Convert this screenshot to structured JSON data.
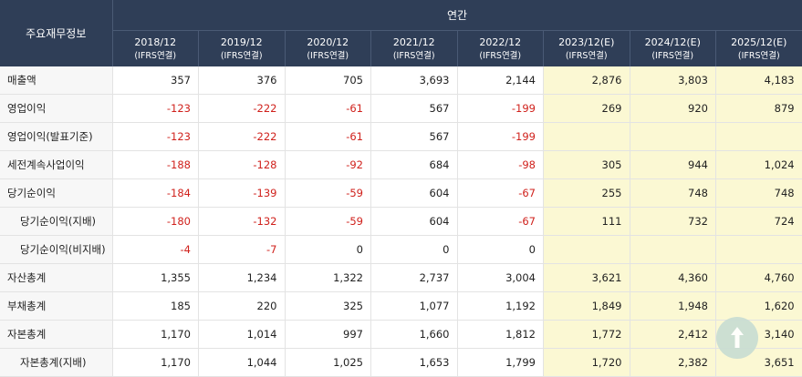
{
  "header": {
    "label": "주요재무정보",
    "span": "연간",
    "years": [
      {
        "year": "2018/12",
        "sub": "(IFRS연결)"
      },
      {
        "year": "2019/12",
        "sub": "(IFRS연결)"
      },
      {
        "year": "2020/12",
        "sub": "(IFRS연결)"
      },
      {
        "year": "2021/12",
        "sub": "(IFRS연결)"
      },
      {
        "year": "2022/12",
        "sub": "(IFRS연결)"
      },
      {
        "year": "2023/12(E)",
        "sub": "(IFRS연결)"
      },
      {
        "year": "2024/12(E)",
        "sub": "(IFRS연결)"
      },
      {
        "year": "2025/12(E)",
        "sub": "(IFRS연결)"
      }
    ]
  },
  "rows": [
    {
      "label": "매출액",
      "indent": false,
      "total": false,
      "values": [
        "357",
        "376",
        "705",
        "3,693",
        "2,144",
        "2,876",
        "3,803",
        "4,183"
      ]
    },
    {
      "label": "영업이익",
      "indent": false,
      "total": false,
      "values": [
        "-123",
        "-222",
        "-61",
        "567",
        "-199",
        "269",
        "920",
        "879"
      ]
    },
    {
      "label": "영업이익(발표기준)",
      "indent": false,
      "total": false,
      "values": [
        "-123",
        "-222",
        "-61",
        "567",
        "-199",
        "",
        "",
        ""
      ]
    },
    {
      "label": "세전계속사업이익",
      "indent": false,
      "total": false,
      "values": [
        "-188",
        "-128",
        "-92",
        "684",
        "-98",
        "305",
        "944",
        "1,024"
      ]
    },
    {
      "label": "당기순이익",
      "indent": false,
      "total": false,
      "values": [
        "-184",
        "-139",
        "-59",
        "604",
        "-67",
        "255",
        "748",
        "748"
      ]
    },
    {
      "label": "당기순이익(지배)",
      "indent": true,
      "total": false,
      "values": [
        "-180",
        "-132",
        "-59",
        "604",
        "-67",
        "111",
        "732",
        "724"
      ]
    },
    {
      "label": "당기순이익(비지배)",
      "indent": true,
      "total": false,
      "values": [
        "-4",
        "-7",
        "0",
        "0",
        "0",
        "",
        "",
        ""
      ]
    },
    {
      "label": "자산총계",
      "indent": false,
      "total": true,
      "values": [
        "1,355",
        "1,234",
        "1,322",
        "2,737",
        "3,004",
        "3,621",
        "4,360",
        "4,760"
      ]
    },
    {
      "label": "부채총계",
      "indent": false,
      "total": false,
      "values": [
        "185",
        "220",
        "325",
        "1,077",
        "1,192",
        "1,849",
        "1,948",
        "1,620"
      ]
    },
    {
      "label": "자본총계",
      "indent": false,
      "total": false,
      "values": [
        "1,170",
        "1,014",
        "997",
        "1,660",
        "1,812",
        "1,772",
        "2,412",
        "3,140"
      ]
    },
    {
      "label": "자본총계(지배)",
      "indent": true,
      "total": false,
      "values": [
        "1,170",
        "1,044",
        "1,025",
        "1,653",
        "1,799",
        "1,720",
        "2,382",
        "3,651"
      ]
    }
  ],
  "estimate_columns": [
    5,
    6,
    7
  ],
  "colors": {
    "header_bg": "#2f3e57",
    "estimate_bg": "#fbf8d3",
    "negative": "#d0211c"
  },
  "scroll_top": {
    "icon": "arrow-up-icon"
  }
}
